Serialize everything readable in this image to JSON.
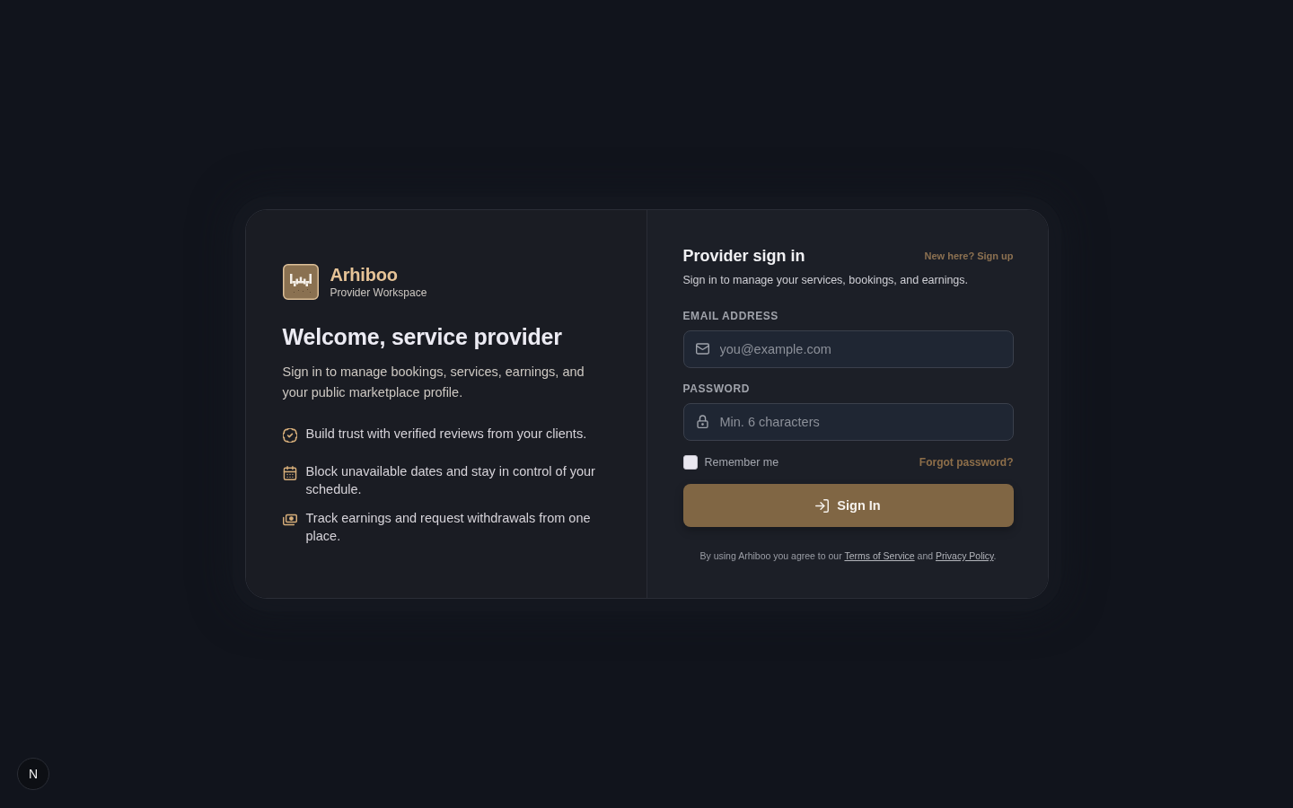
{
  "brand": {
    "name": "Arhiboo",
    "subtitle": "Provider Workspace"
  },
  "intro": {
    "heading": "Welcome, service provider",
    "text": "Sign in to manage bookings, services, earnings, and your public marketplace profile."
  },
  "features": [
    {
      "text": "Build trust with verified reviews from your clients."
    },
    {
      "text": "Block unavailable dates and stay in control of your schedule."
    },
    {
      "text": "Track earnings and request withdrawals from one place."
    }
  ],
  "sign_in": {
    "title": "Provider sign in",
    "signup_link": "New here? Sign up",
    "subtitle": "Sign in to manage your services, bookings, and earnings.",
    "fields": [
      {
        "kind": "email",
        "label": "EMAIL ADDRESS",
        "placeholder": "you@example.com"
      },
      {
        "kind": "password",
        "label": "PASSWORD",
        "placeholder": "Min. 6 characters"
      }
    ],
    "remember": {
      "label": "Remember me",
      "checked": false
    },
    "forgot_link": "Forgot password?",
    "submit": "Sign In",
    "legal": [
      {
        "kind": "text",
        "text": "By using Arhiboo you agree to our "
      },
      {
        "kind": "link",
        "text": "Terms of Service"
      },
      {
        "kind": "text",
        "text": " and "
      },
      {
        "kind": "link",
        "text": "Privacy Policy"
      },
      {
        "kind": "text",
        "text": "."
      }
    ]
  },
  "dev_badge": {
    "label": "N"
  }
}
